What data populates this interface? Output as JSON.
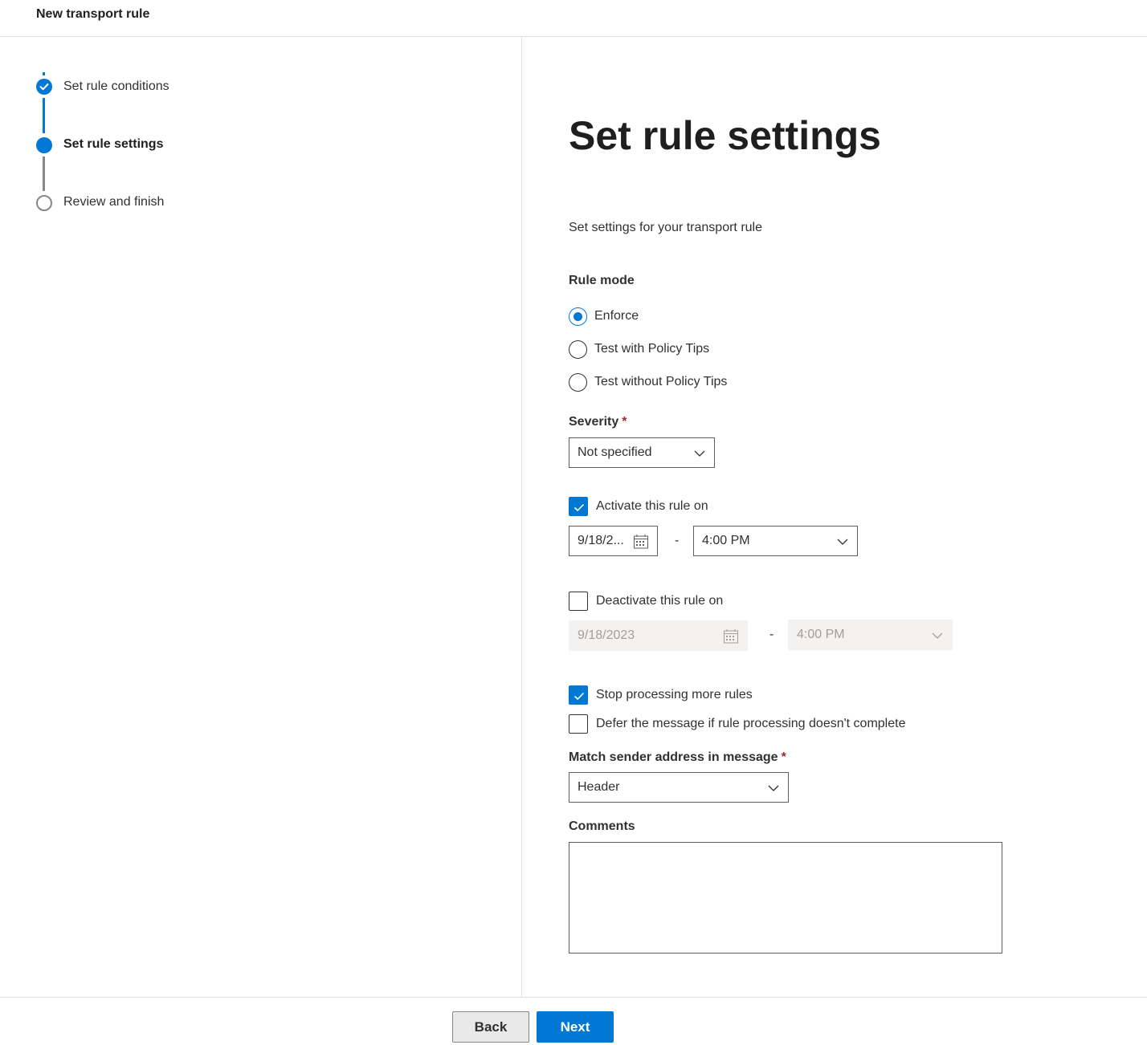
{
  "header": {
    "title": "New transport rule"
  },
  "steps": [
    {
      "label": "Set rule conditions",
      "state": "completed"
    },
    {
      "label": "Set rule settings",
      "state": "current"
    },
    {
      "label": "Review and finish",
      "state": "pending"
    }
  ],
  "main": {
    "title": "Set rule settings",
    "subtitle": "Set settings for your transport rule",
    "rule_mode": {
      "label": "Rule mode",
      "options": [
        "Enforce",
        "Test with Policy Tips",
        "Test without Policy Tips"
      ],
      "selected": "Enforce"
    },
    "severity": {
      "label": "Severity",
      "required_mark": "*",
      "value": "Not specified"
    },
    "activate": {
      "label": "Activate this rule on",
      "checked": true,
      "date": "9/18/2...",
      "separator": "-",
      "time": "4:00 PM"
    },
    "deactivate": {
      "label": "Deactivate this rule on",
      "checked": false,
      "date": "9/18/2023",
      "separator": "-",
      "time": "4:00 PM"
    },
    "stop_processing": {
      "label": "Stop processing more rules",
      "checked": true
    },
    "defer_message": {
      "label": "Defer the message if rule processing doesn't complete",
      "checked": false
    },
    "match_sender": {
      "label": "Match sender address in message",
      "required_mark": "*",
      "value": "Header"
    },
    "comments": {
      "label": "Comments",
      "value": ""
    }
  },
  "footer": {
    "back_label": "Back",
    "next_label": "Next"
  },
  "colors": {
    "accent": "#0078d4",
    "required": "#a4262c",
    "border": "#e1dfdd"
  }
}
